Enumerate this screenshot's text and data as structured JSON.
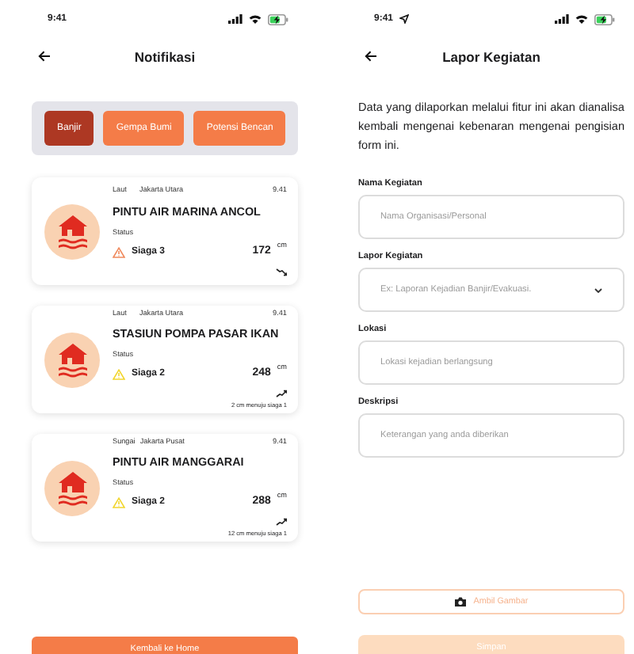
{
  "notifications": {
    "status_bar": {
      "time": "9:41"
    },
    "header": {
      "title": "Notifikasi"
    },
    "tabs": [
      {
        "label": "Banjir",
        "selected": true
      },
      {
        "label": "Gempa Bumi",
        "selected": false
      },
      {
        "label": "Potensi Bencan",
        "selected": false
      }
    ],
    "cards": [
      {
        "category": "Laut",
        "region": "Jakarta Utara",
        "time": "9.41",
        "name": "PINTU AIR MARINA ANCOL",
        "status_label": "Status",
        "level_value": "172",
        "unit": "cm",
        "rising": false,
        "alert": "Siaga 3",
        "color": "#f08a5d"
      },
      {
        "category": "Laut",
        "region": "Jakarta Utara",
        "time": "9.41",
        "name": "STASIUN POMPA PASAR IKAN",
        "status_label": "Status",
        "level_value": "248",
        "unit": "cm",
        "rising": true,
        "alert": "Siaga 2",
        "color": "#f2d630",
        "note": "2 cm menuju siaga 1"
      },
      {
        "category": "Sungai",
        "region": "Jakarta Pusat",
        "time": "9.41",
        "name": "PINTU AIR MANGGARAI",
        "status_label": "Status",
        "level_value": "288",
        "unit": "cm",
        "rising": true,
        "alert": "Siaga 2",
        "color": "#f2d630",
        "note": "12 cm menuju siaga 1"
      }
    ],
    "home_button": "Kembali ke Home"
  },
  "report": {
    "status_bar": {
      "time": "9:41"
    },
    "header": {
      "title": "Lapor Kegiatan"
    },
    "intro": "Data yang dilaporkan melalui fitur ini akan dianalisa kembali mengenai kebenaran mengenai pengisian form ini.",
    "fields": [
      {
        "kind": "text",
        "label": "Nama Kegiatan",
        "placeholder": "Nama Organisasi/Personal"
      },
      {
        "kind": "select",
        "label": "Lapor Kegiatan",
        "placeholder": "Ex: Laporan Kejadian Banjir/Evakuasi."
      },
      {
        "kind": "text",
        "label": "Lokasi",
        "placeholder": "Lokasi kejadian berlangsung"
      },
      {
        "kind": "text",
        "label": "Deskripsi",
        "placeholder": "Keterangan yang anda diberikan"
      }
    ],
    "photo_button": "Ambil Gambar",
    "save_button": "Simpan"
  }
}
